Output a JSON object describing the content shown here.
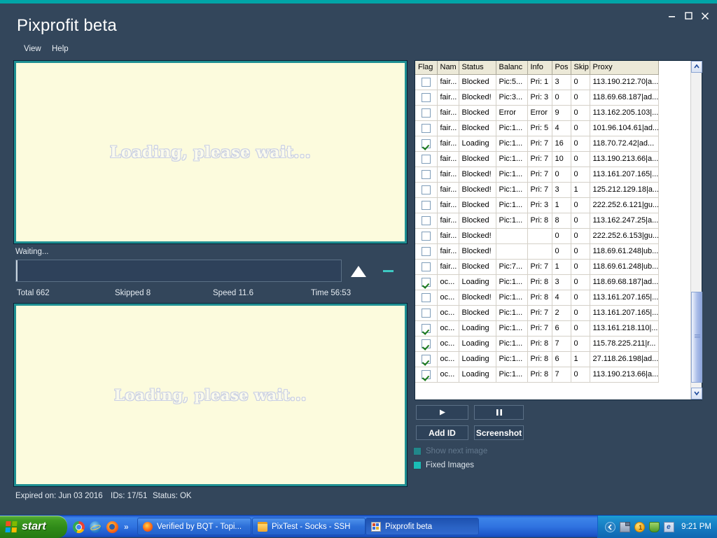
{
  "window": {
    "title": "Pixprofit beta",
    "menu": [
      {
        "label": "View",
        "name": "menu-view"
      },
      {
        "label": "Help",
        "name": "menu-help"
      }
    ],
    "controls": {
      "minimize": "minimize-icon",
      "maximize": "maximize-icon",
      "close": "close-icon"
    },
    "accent_color": "#00a5a8",
    "chrome_color": "#33465b"
  },
  "preview": {
    "top_text": "Loading, please wait...",
    "bottom_text": "Loading, please wait...",
    "background_color": "#fcfbdd",
    "border_color": "#1f8f92"
  },
  "progress": {
    "status_label": "Waiting...",
    "percent": 0,
    "up_arrow_icon": "triangle-up-icon",
    "dash_icon": "dash-icon",
    "stats": {
      "total": "Total 662",
      "skipped": "Skipped 8",
      "speed": "Speed 11.6",
      "time": "Time 56:53"
    }
  },
  "footer": {
    "expired": "Expired on: Jun 03 2016",
    "ids": "IDs: 17/51",
    "status": "Status: OK"
  },
  "grid": {
    "columns": [
      "Flag",
      "Nam",
      "Status",
      "Balanc",
      "Info",
      "Pos",
      "Skip",
      "Proxy"
    ],
    "rows": [
      {
        "flag": false,
        "name": "fair...",
        "status": "Blocked",
        "balance": "Pic:5...",
        "info": "Pri: 1",
        "pos": "3",
        "skip": "0",
        "proxy": "113.190.212.70|a..."
      },
      {
        "flag": false,
        "name": "fair...",
        "status": "Blocked!",
        "balance": "Pic:3...",
        "info": "Pri: 3",
        "pos": "0",
        "skip": "0",
        "proxy": "118.69.68.187|ad..."
      },
      {
        "flag": false,
        "name": "fair...",
        "status": "Blocked",
        "balance": "Error",
        "info": "Error",
        "pos": "9",
        "skip": "0",
        "proxy": "113.162.205.103|..."
      },
      {
        "flag": false,
        "name": "fair...",
        "status": "Blocked",
        "balance": "Pic:1...",
        "info": "Pri: 5",
        "pos": "4",
        "skip": "0",
        "proxy": "101.96.104.61|ad..."
      },
      {
        "flag": true,
        "name": "fair...",
        "status": "Loading",
        "balance": "Pic:1...",
        "info": "Pri: 7",
        "pos": "16",
        "skip": "0",
        "proxy": "118.70.72.42|ad..."
      },
      {
        "flag": false,
        "name": "fair...",
        "status": "Blocked",
        "balance": "Pic:1...",
        "info": "Pri: 7",
        "pos": "10",
        "skip": "0",
        "proxy": "113.190.213.66|a..."
      },
      {
        "flag": false,
        "name": "fair...",
        "status": "Blocked!",
        "balance": "Pic:1...",
        "info": "Pri: 7",
        "pos": "0",
        "skip": "0",
        "proxy": "113.161.207.165|..."
      },
      {
        "flag": false,
        "name": "fair...",
        "status": "Blocked!",
        "balance": "Pic:1...",
        "info": "Pri: 7",
        "pos": "3",
        "skip": "1",
        "proxy": "125.212.129.18|a..."
      },
      {
        "flag": false,
        "name": "fair...",
        "status": "Blocked",
        "balance": "Pic:1...",
        "info": "Pri: 3",
        "pos": "1",
        "skip": "0",
        "proxy": "222.252.6.121|gu..."
      },
      {
        "flag": false,
        "name": "fair...",
        "status": "Blocked",
        "balance": "Pic:1...",
        "info": "Pri: 8",
        "pos": "8",
        "skip": "0",
        "proxy": "113.162.247.25|a..."
      },
      {
        "flag": false,
        "name": "fair...",
        "status": "Blocked!",
        "balance": "",
        "info": "",
        "pos": "0",
        "skip": "0",
        "proxy": "222.252.6.153|gu..."
      },
      {
        "flag": false,
        "name": "fair...",
        "status": "Blocked!",
        "balance": "",
        "info": "",
        "pos": "0",
        "skip": "0",
        "proxy": "118.69.61.248|ub..."
      },
      {
        "flag": false,
        "name": "fair...",
        "status": "Blocked",
        "balance": "Pic:7...",
        "info": "Pri: 7",
        "pos": "1",
        "skip": "0",
        "proxy": "118.69.61.248|ub..."
      },
      {
        "flag": true,
        "name": "oc...",
        "status": "Loading",
        "balance": "Pic:1...",
        "info": "Pri: 8",
        "pos": "3",
        "skip": "0",
        "proxy": "118.69.68.187|ad..."
      },
      {
        "flag": false,
        "name": "oc...",
        "status": "Blocked!",
        "balance": "Pic:1...",
        "info": "Pri: 8",
        "pos": "4",
        "skip": "0",
        "proxy": "113.161.207.165|..."
      },
      {
        "flag": false,
        "name": "oc...",
        "status": "Blocked",
        "balance": "Pic:1...",
        "info": "Pri: 7",
        "pos": "2",
        "skip": "0",
        "proxy": "113.161.207.165|..."
      },
      {
        "flag": true,
        "name": "oc...",
        "status": "Loading",
        "balance": "Pic:1...",
        "info": "Pri: 7",
        "pos": "6",
        "skip": "0",
        "proxy": "113.161.218.110|..."
      },
      {
        "flag": true,
        "name": "oc...",
        "status": "Loading",
        "balance": "Pic:1...",
        "info": "Pri: 8",
        "pos": "7",
        "skip": "0",
        "proxy": "115.78.225.211|r..."
      },
      {
        "flag": true,
        "name": "oc...",
        "status": "Loading",
        "balance": "Pic:1...",
        "info": "Pri: 8",
        "pos": "6",
        "skip": "1",
        "proxy": "27.118.26.198|ad..."
      },
      {
        "flag": true,
        "name": "oc...",
        "status": "Loading",
        "balance": "Pic:1...",
        "info": "Pri: 8",
        "pos": "7",
        "skip": "0",
        "proxy": "113.190.213.66|a..."
      }
    ]
  },
  "controls": {
    "play_label": "",
    "pause_label": "",
    "play_icon": "play-icon",
    "pause_icon": "pause-icon",
    "add_id_label": "Add ID",
    "screenshot_label": "Screenshot",
    "show_next_image": {
      "label": "Show next image",
      "checked": true,
      "enabled": false
    },
    "fixed_images": {
      "label": "Fixed Images",
      "checked": true,
      "enabled": true
    }
  },
  "taskbar": {
    "start_label": "start",
    "quicklaunch": [
      "chrome-icon",
      "internet-explorer-icon",
      "firefox-icon"
    ],
    "overflow": "»",
    "tasks": [
      {
        "label": "Verified by BQT - Topi...",
        "icon": "firefox-icon",
        "active": false
      },
      {
        "label": "PixTest - Socks - SSH",
        "icon": "folder-icon",
        "active": false
      },
      {
        "label": "Pixprofit beta",
        "icon": "app-icon",
        "active": true
      }
    ],
    "tray_icons": [
      "show-hidden-icon",
      "network-icon",
      "update-icon",
      "shield-icon",
      "ie-icon"
    ],
    "clock": "9:21 PM"
  }
}
